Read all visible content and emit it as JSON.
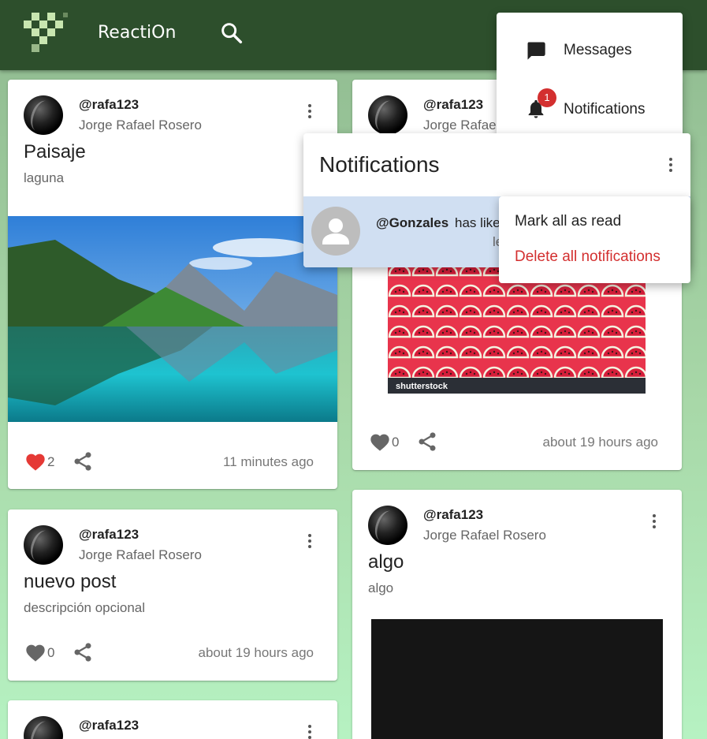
{
  "appbar": {
    "title": "ReactiOn"
  },
  "colors": {
    "appbar": "#2d4f2c",
    "liked_heart": "#e53935",
    "danger": "#d32f2f",
    "unread_notification_bg": "#d0dff2"
  },
  "posts": [
    {
      "handle": "@rafa123",
      "name": "Jorge Rafael Rosero",
      "title": "Paisaje",
      "description": "laguna",
      "image": "mountain-lake-landscape",
      "likes": "2",
      "liked": true,
      "time": "11 minutes ago"
    },
    {
      "handle": "@rafa123",
      "name": "Jorge Rafael Rosero",
      "title": "nuevo post",
      "description": "descripción opcional",
      "likes": "0",
      "liked": false,
      "time": "about 19 hours ago"
    },
    {
      "handle": "@rafa123",
      "name": "Jorge Rafael Rosero",
      "image": "watermelon-pattern",
      "image_watermark": "shutterstock",
      "likes": "0",
      "liked": false,
      "time": "about 19 hours ago"
    },
    {
      "handle": "@rafa123",
      "name": "Jorge Rafael Rosero",
      "title": "algo",
      "description": "algo",
      "image": "black-image"
    },
    {
      "handle": "@rafa123"
    }
  ],
  "account_menu": {
    "items": [
      {
        "label": "Messages",
        "icon": "chat-icon"
      },
      {
        "label": "Notifications",
        "icon": "bell-icon",
        "badge": "1"
      }
    ]
  },
  "notifications_panel": {
    "title": "Notifications",
    "items": [
      {
        "user": "@Gonzales",
        "text": "has like",
        "second_line": "le",
        "read": false
      }
    ]
  },
  "notifications_options_menu": {
    "items": [
      {
        "label": "Mark all as read"
      },
      {
        "label": "Delete all notifications"
      }
    ]
  }
}
